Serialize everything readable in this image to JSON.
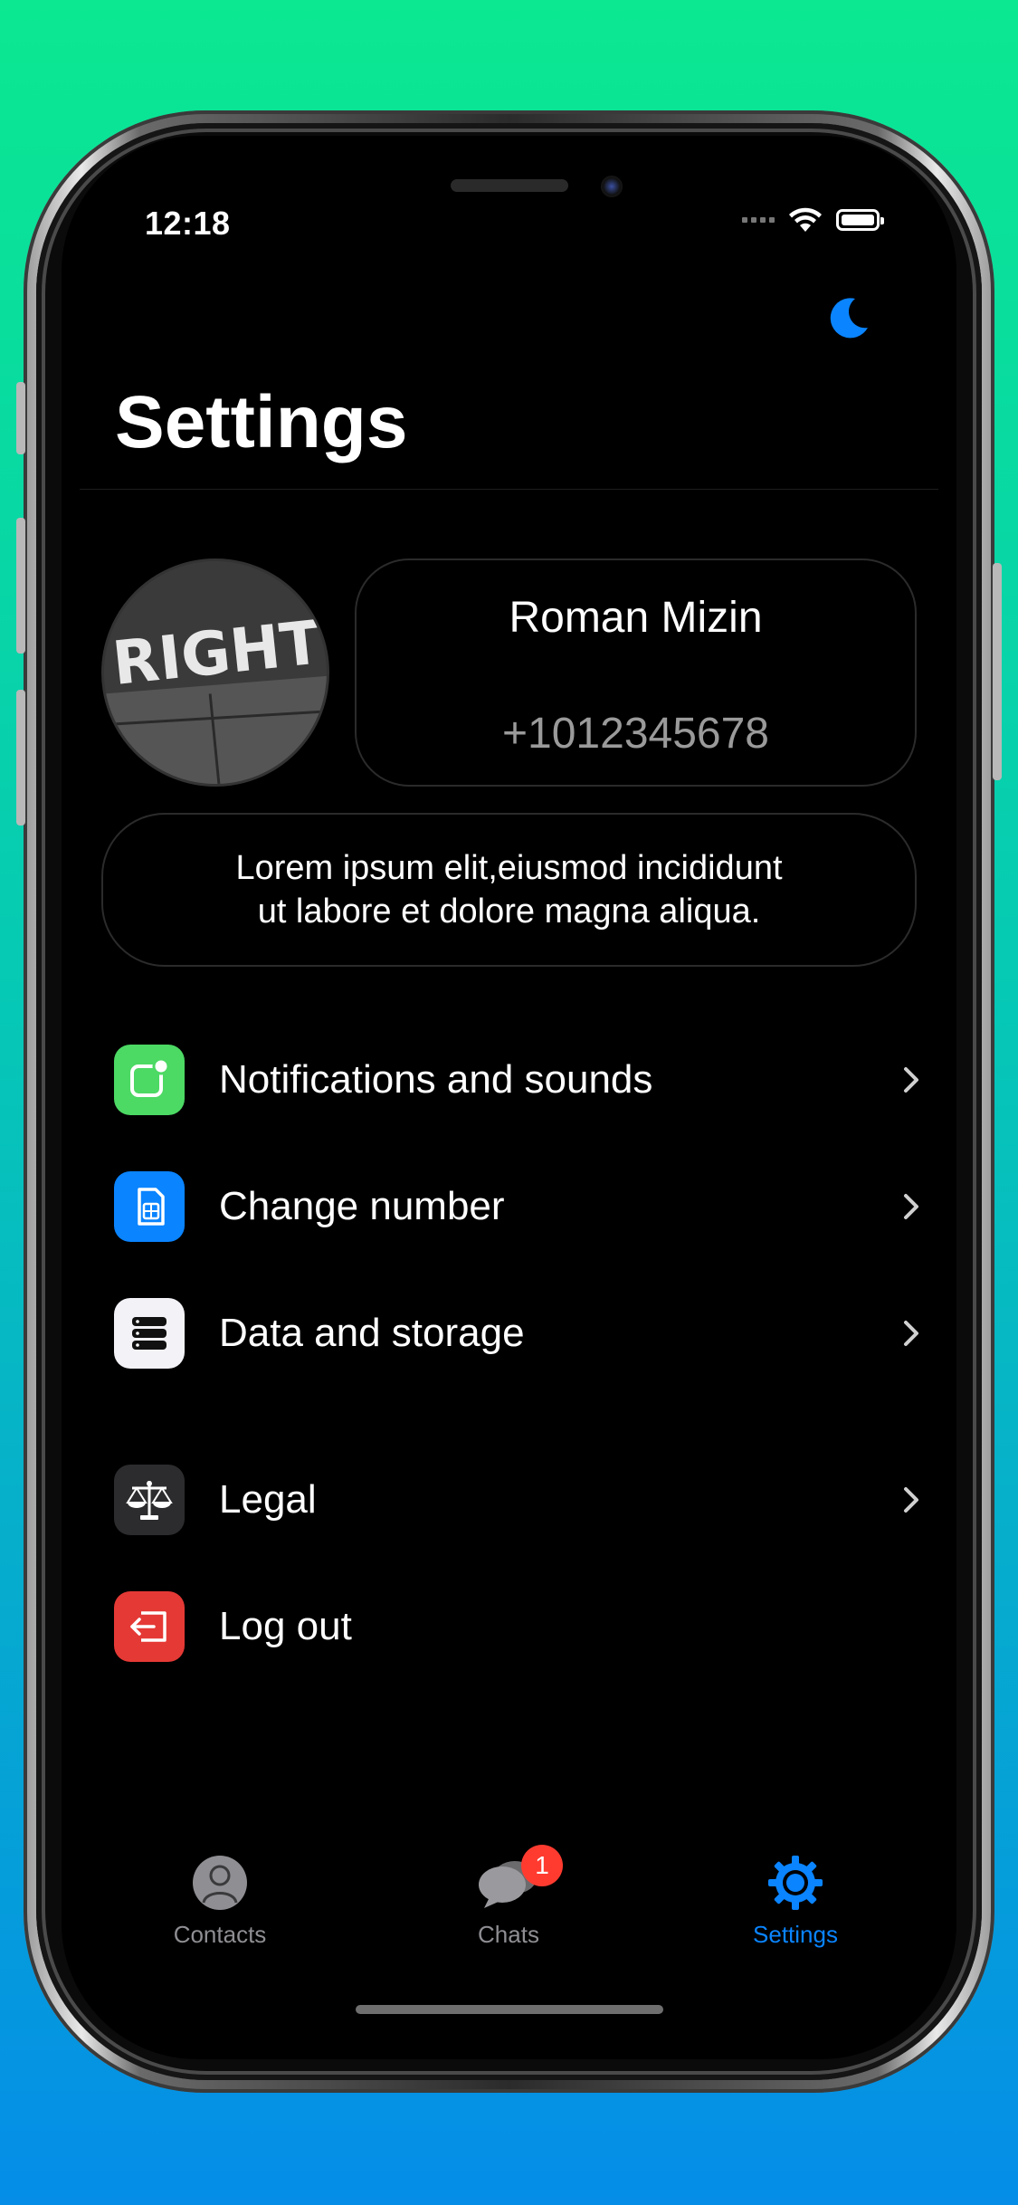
{
  "status_bar": {
    "time": "12:18"
  },
  "header": {
    "title": "Settings",
    "theme_toggle_icon": "moon-icon"
  },
  "profile": {
    "avatar_text": "RIGHT",
    "name": "Roman Mizin",
    "phone": "+1012345678",
    "bio_line1": "Lorem ipsum elit,eiusmod incididunt",
    "bio_line2": "ut labore et dolore magna aliqua."
  },
  "menu": {
    "items": [
      {
        "label": "Notifications and sounds",
        "icon": "notification-icon",
        "color": "#4cd964"
      },
      {
        "label": "Change number",
        "icon": "sim-card-icon",
        "color": "#0a84ff"
      },
      {
        "label": "Data and storage",
        "icon": "storage-icon",
        "color": "#f2f2f7"
      },
      {
        "label": "Legal",
        "icon": "scales-icon",
        "color": "#2c2c2e"
      },
      {
        "label": "Log out",
        "icon": "logout-icon",
        "color": "#e53935"
      }
    ]
  },
  "tabbar": {
    "tabs": [
      {
        "label": "Contacts",
        "icon": "person-icon"
      },
      {
        "label": "Chats",
        "icon": "chat-bubbles-icon",
        "badge": "1"
      },
      {
        "label": "Settings",
        "icon": "gear-icon",
        "active": true
      }
    ]
  },
  "colors": {
    "accent": "#0a84ff",
    "badge": "#ff3b30",
    "background": "#000000"
  }
}
